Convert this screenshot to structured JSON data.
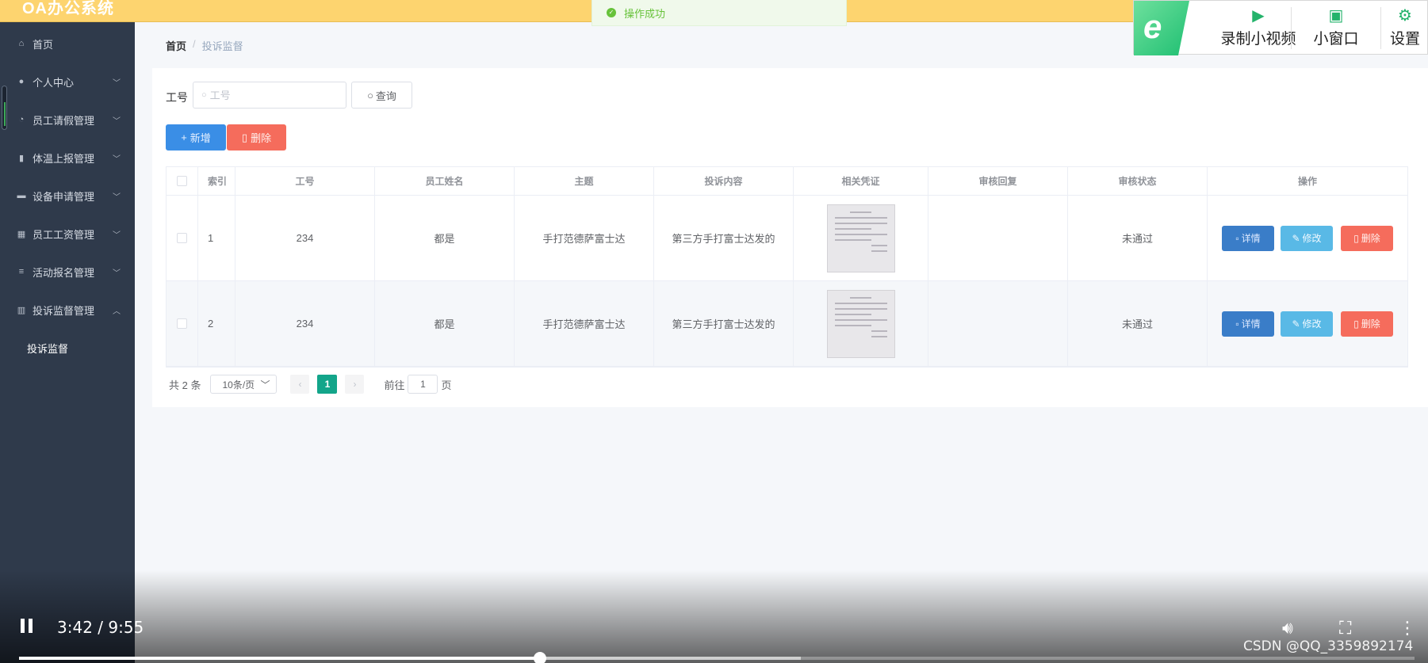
{
  "app": {
    "title": "OA办公系统"
  },
  "toast": {
    "message": "操作成功"
  },
  "recorder": {
    "record_label": "录制小视频",
    "window_label": "小窗口",
    "settings_label": "设置",
    "logo_glyph": "e"
  },
  "sidebar": {
    "items": [
      {
        "label": "首页",
        "icon": "home-icon",
        "glyph": "⌂"
      },
      {
        "label": "个人中心",
        "icon": "user-icon",
        "glyph": "●"
      },
      {
        "label": "员工请假管理",
        "icon": "bell-icon",
        "glyph": "◔"
      },
      {
        "label": "体温上报管理",
        "icon": "clipboard-icon",
        "glyph": "▮"
      },
      {
        "label": "设备申请管理",
        "icon": "briefcase-icon",
        "glyph": "▬"
      },
      {
        "label": "员工工资管理",
        "icon": "grid-icon",
        "glyph": "▦"
      },
      {
        "label": "活动报名管理",
        "icon": "list-icon",
        "glyph": "≡"
      },
      {
        "label": "投诉监督管理",
        "icon": "chart-icon",
        "glyph": "▥"
      }
    ],
    "chevron_down": "﹀",
    "chevron_up": "︿",
    "submenu": [
      {
        "label": "投诉监督"
      }
    ]
  },
  "breadcrumb": {
    "home": "首页",
    "separator": "/",
    "current": "投诉监督"
  },
  "search": {
    "label": "工号",
    "placeholder": "工号",
    "query_button": "查询"
  },
  "toolbar": {
    "add_button": "新增",
    "delete_button": "删除"
  },
  "table": {
    "columns": [
      "索引",
      "工号",
      "员工姓名",
      "主题",
      "投诉内容",
      "相关凭证",
      "审核回复",
      "审核状态",
      "操作"
    ],
    "rows": [
      {
        "index": "1",
        "emp_no": "234",
        "name": "都是",
        "topic": "手打范德萨富士达",
        "content": "第三方手打富士达发的",
        "reply": "",
        "status": "未通过"
      },
      {
        "index": "2",
        "emp_no": "234",
        "name": "都是",
        "topic": "手打范德萨富士达",
        "content": "第三方手打富士达发的",
        "reply": "",
        "status": "未通过"
      }
    ],
    "actions": {
      "detail": "详情",
      "edit": "修改",
      "delete": "删除"
    }
  },
  "pagination": {
    "total_text": "共 2 条",
    "page_size": "10条/页",
    "current_page": "1",
    "goto_prefix": "前往",
    "goto_value": "1",
    "goto_suffix": "页"
  },
  "video": {
    "time": "3:42 / 9:55",
    "progress": 0.3731,
    "buffered": 0.56,
    "watermark": "CSDN @QQ_3359892174"
  }
}
